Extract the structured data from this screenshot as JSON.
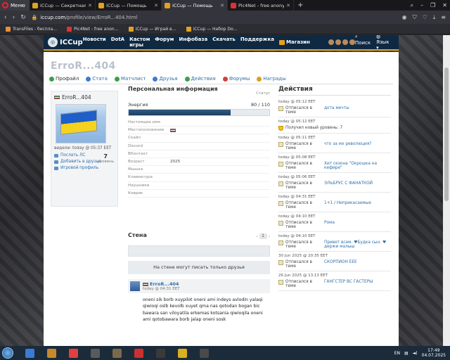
{
  "browser": {
    "menu_label": "Меню",
    "tabs": [
      {
        "title": "iCCup — Секретная инфо…",
        "color": "#e0a31f"
      },
      {
        "title": "iCCup — Помощь",
        "color": "#e0a31f"
      },
      {
        "title": "iCCup — Помощь",
        "color": "#e0a31f"
      },
      {
        "title": "Pic4Net - free anonymou…",
        "color": "#d33"
      }
    ],
    "active_tab_index": 2,
    "url_host": "iccup.com",
    "url_path": "/profile/view/ErroR...404.html",
    "bookmarks": [
      "TransFiles - беспла…",
      "Pic4Net - free anon…",
      "iCCup — Играй в…",
      "iCCup — Набор Do…"
    ]
  },
  "site_nav": {
    "logo": "ICCup",
    "links": [
      "Новости",
      "DotA",
      "Кастом игры",
      "Форум",
      "Инфобаза",
      "Скачать",
      "Поддержка"
    ],
    "shop": "Магазин",
    "search": "Поиск",
    "language": "Язык"
  },
  "profile": {
    "title": "ErroR...404",
    "tabs": [
      "Профайл",
      "Стата",
      "Матчлист",
      "Друзья",
      "Действия",
      "Форумы",
      "Награды"
    ],
    "card": {
      "name": "ErroR...404",
      "seen": "видели: today @ 05:37 EET",
      "links": [
        "Послать ЛС",
        "Добавить в друзья",
        "Игровой профиль"
      ],
      "level": "7",
      "level_label": "уровень"
    }
  },
  "personal": {
    "heading": "Персональная информация",
    "status_label": "Статус",
    "energy_label": "Энергия",
    "energy_value": "80 / 110",
    "energy_current": 80,
    "energy_max": 110,
    "fields": [
      {
        "label": "Настоящее имя",
        "value": ""
      },
      {
        "label": "Местоположение",
        "value": "",
        "flag": true
      },
      {
        "label": "Скайп",
        "value": ""
      },
      {
        "label": "Discord",
        "value": ""
      },
      {
        "label": "ВКонтакт",
        "value": ""
      },
      {
        "label": "Возраст",
        "value": "2025"
      },
      {
        "label": "Мышка",
        "value": ""
      },
      {
        "label": "Клавиатура",
        "value": ""
      },
      {
        "label": "Наушники",
        "value": ""
      },
      {
        "label": "Коврик",
        "value": ""
      }
    ]
  },
  "wall": {
    "heading": "Стена",
    "page": "1",
    "notice": "На стене могут писать только друзья",
    "post": {
      "author": "ErroR...404",
      "date": "today @ 04:31 EET",
      "text": "oneni sik borb xuypilot oneni ami indeys avlodin yalaqi qiwioqi oslb kevolb xuyet qma nas qotodan bogan bic bawara san viloyatila erkemas kotsania qiwioqila oneni ami qotobawara borb jalap oneni sosk"
    }
  },
  "actions": {
    "heading": "Действия",
    "items": [
      {
        "date": "today @ 05:12 EET",
        "text": "Отписался в теме",
        "link": "дота мечты"
      },
      {
        "date": "today @ 05:12 EET",
        "text": "Получил новый уровень: 7",
        "link": "",
        "icon": "shield"
      },
      {
        "date": "today @ 05:11 EET",
        "text": "Отписался в теме",
        "link": "что за мх революция?"
      },
      {
        "date": "today @ 05:08 EET",
        "text": "Отписался в теме",
        "link": "Хит сезона \"Окрошка на кефире\""
      },
      {
        "date": "today @ 05:06 EET",
        "text": "Отписался в теме",
        "link": "ЭЛЬБРУС С ФАНАТКОЙ"
      },
      {
        "date": "today @ 04:31 EET",
        "text": "Отписался в теме",
        "link": "1+1 / Неприкасаемые"
      },
      {
        "date": "today @ 04:10 EET",
        "text": "Отписался в теме",
        "link": "Рома"
      },
      {
        "date": "today @ 04:10 EET",
        "text": "Отписался в теме",
        "link": "Привет всем. ♥Будка сын. ♥ держи малыш"
      },
      {
        "date": "30 Jun 2025 @ 20:35 EET",
        "text": "Отписался в теме",
        "link": "СКОРПИОН EEE"
      },
      {
        "date": "26 Jun 2025 @ 13:13 EET",
        "text": "Отписался в теме",
        "link": "ГАНГСТЕР ВС ГАСТЕРЫ"
      }
    ]
  },
  "taskbar": {
    "apps": [
      "#3a7bd5",
      "#c58a2a",
      "#e04040",
      "#5a5a5a",
      "#7a6a4a",
      "#cc3030",
      "#3a3a3a",
      "#d8b020",
      "#4a4a4a"
    ],
    "lang": "EN",
    "time": "17:49",
    "date": "04.07.2025"
  }
}
